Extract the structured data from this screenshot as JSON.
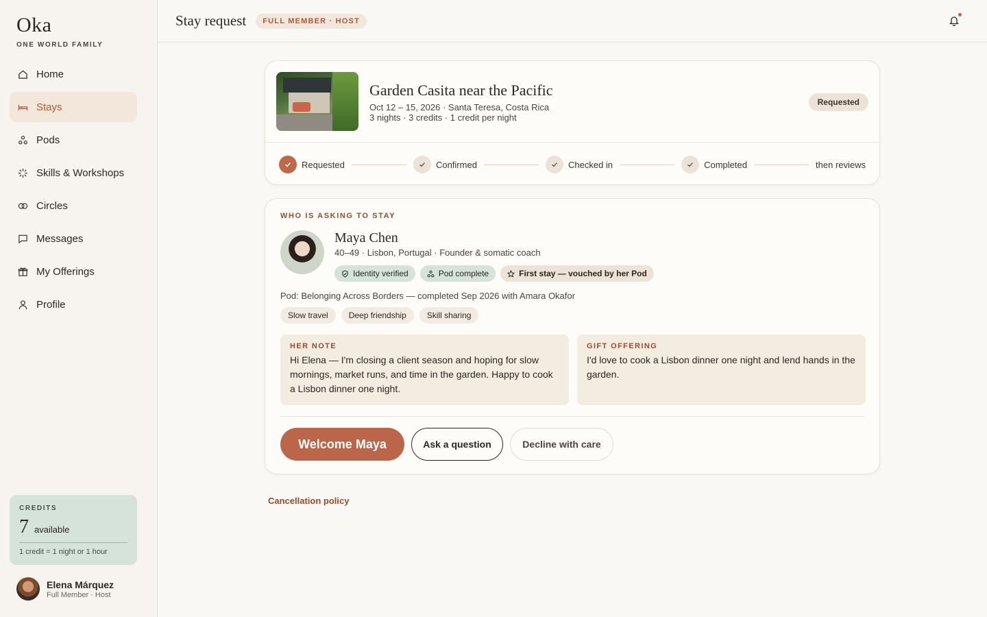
{
  "brand": {
    "name": "Oka",
    "tagline": "ONE WORLD FAMILY"
  },
  "sidebar": {
    "items": [
      {
        "label": "Home",
        "icon": "home-icon"
      },
      {
        "label": "Stays",
        "icon": "bed-icon",
        "active": true
      },
      {
        "label": "Pods",
        "icon": "pods-icon"
      },
      {
        "label": "Skills & Workshops",
        "icon": "sparkle-icon"
      },
      {
        "label": "Circles",
        "icon": "circles-icon"
      },
      {
        "label": "Messages",
        "icon": "message-icon"
      },
      {
        "label": "My Offerings",
        "icon": "gift-icon"
      },
      {
        "label": "Profile",
        "icon": "user-icon"
      }
    ],
    "credits": {
      "label": "CREDITS",
      "count": "7",
      "available_label": "available",
      "note": "1 credit = 1 night or 1 hour"
    },
    "user": {
      "name": "Elena Márquez",
      "role": "Full Member · Host"
    }
  },
  "header": {
    "title": "Stay request",
    "badge": "FULL MEMBER · HOST",
    "notification_dot": true
  },
  "stay": {
    "title": "Garden Casita near the Pacific",
    "dates_location": "Oct 12 – 15, 2026 · Santa Teresa, Costa Rica",
    "summary": "3 nights · 3 credits · 1 credit per night",
    "status": "Requested",
    "steps": [
      {
        "label": "Requested",
        "state": "done"
      },
      {
        "label": "Confirmed",
        "state": "pending"
      },
      {
        "label": "Checked in",
        "state": "pending"
      },
      {
        "label": "Completed",
        "state": "pending"
      }
    ],
    "steps_end": "then reviews"
  },
  "request": {
    "section_label": "WHO IS ASKING TO STAY",
    "guest": {
      "name": "Maya Chen",
      "meta": "40–49 · Lisbon, Portugal · Founder & somatic coach",
      "badges": [
        {
          "label": "Identity verified",
          "icon": "shield-check-icon"
        },
        {
          "label": "Pod complete",
          "icon": "pods-icon"
        },
        {
          "label": "First stay — vouched by her Pod",
          "icon": "star-icon"
        }
      ],
      "pod_line": "Pod: Belonging Across Borders — completed Sep 2026 with Amara Okafor",
      "tags": [
        "Slow travel",
        "Deep friendship",
        "Skill sharing"
      ]
    },
    "note": {
      "label": "HER NOTE",
      "text": "Hi Elena — I'm closing a client season and hoping for slow mornings, market runs, and time in the garden. Happy to cook a Lisbon dinner one night."
    },
    "gift": {
      "label": "GIFT OFFERING",
      "text": "I'd love to cook a Lisbon dinner one night and lend hands in the garden."
    },
    "actions": {
      "primary": "Welcome Maya",
      "secondary": "Ask a question",
      "tertiary": "Decline with care"
    }
  },
  "footer": {
    "cancellation_link": "Cancellation policy"
  },
  "colors": {
    "accent": "#bb654a",
    "sage": "#d5e3da",
    "sand": "#ece2d6",
    "background": "#faf8f4"
  }
}
